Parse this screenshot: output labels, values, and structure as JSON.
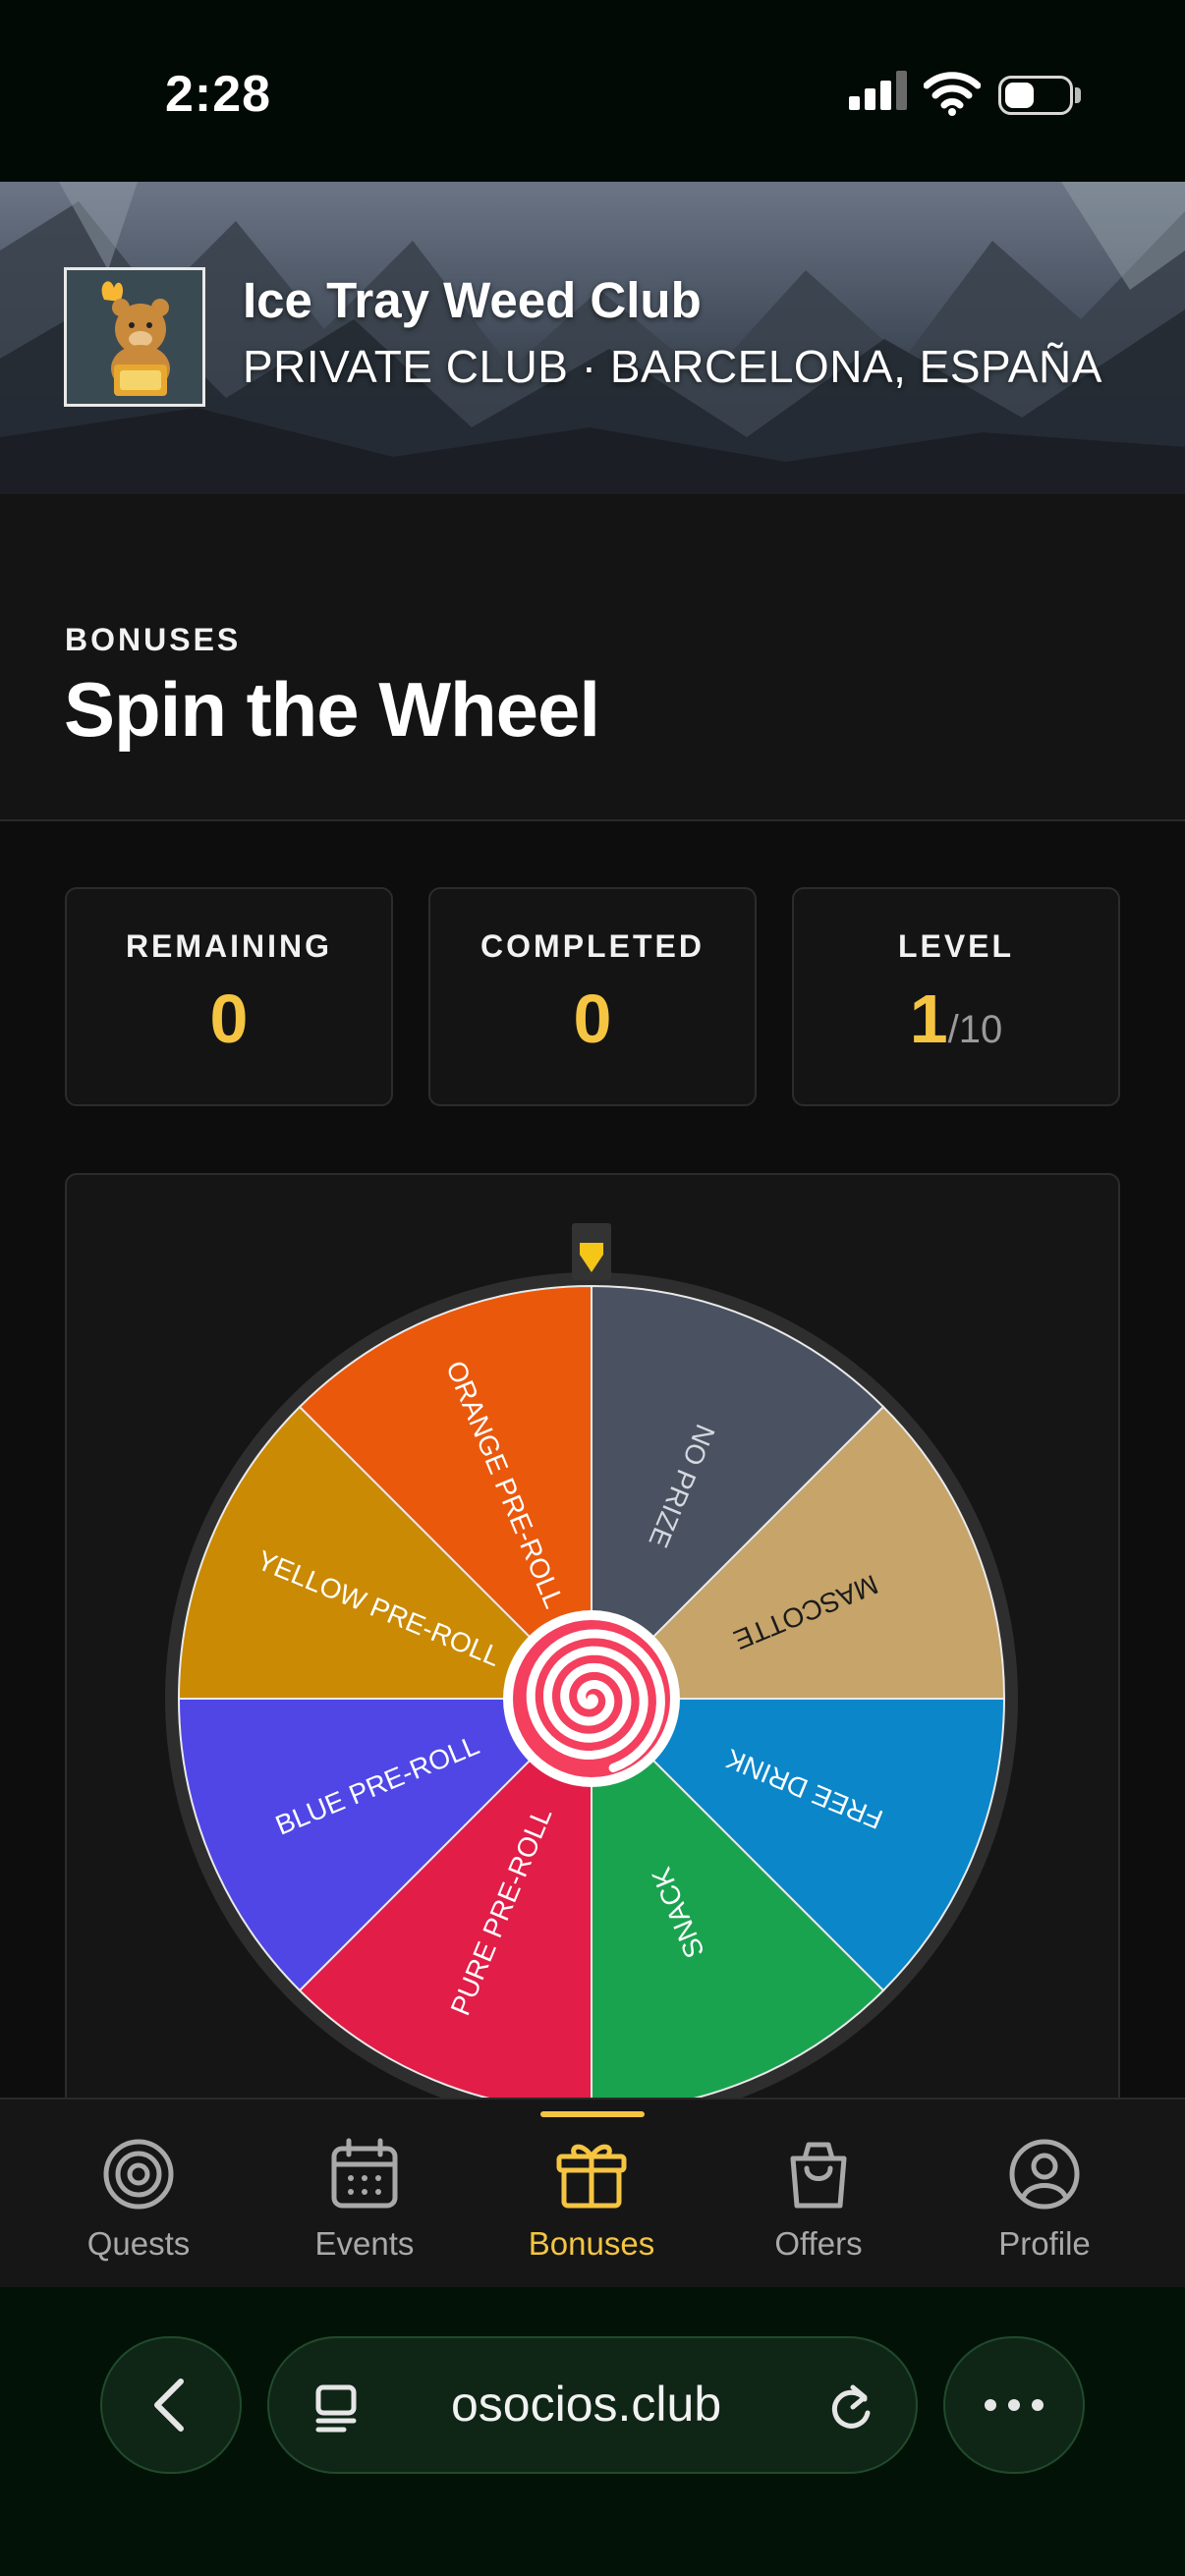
{
  "status_bar": {
    "time": "2:28",
    "battery_level": 0.45
  },
  "club": {
    "name": "Ice Tray Weed Club",
    "subtitle": "PRIVATE CLUB · BARCELONA, ESPAÑA"
  },
  "page": {
    "eyebrow": "BONUSES",
    "title": "Spin the Wheel"
  },
  "stats": {
    "remaining": {
      "label": "REMAINING",
      "value": "0"
    },
    "completed": {
      "label": "COMPLETED",
      "value": "0"
    },
    "level": {
      "label": "LEVEL",
      "value": "1",
      "max": "/10"
    }
  },
  "wheel": {
    "segments": [
      {
        "label": "NO PRIZE",
        "color": "#4a5261",
        "text_color": "#d5d8de"
      },
      {
        "label": "MASCOTTE",
        "color": "#c6a46a",
        "text_color": "#1b1b1b"
      },
      {
        "label": "FREE DRINK",
        "color": "#0a86c9",
        "text_color": "#ffffff"
      },
      {
        "label": "SNACK",
        "color": "#1aa34f",
        "text_color": "#ffffff"
      },
      {
        "label": "PURE PRE-ROLL",
        "color": "#e11d48",
        "text_color": "#ffffff"
      },
      {
        "label": "BLUE PRE-ROLL",
        "color": "#4f46e5",
        "text_color": "#ffffff"
      },
      {
        "label": "YELLOW PRE-ROLL",
        "color": "#ca8a04",
        "text_color": "#ffffff"
      },
      {
        "label": "ORANGE PRE-ROLL",
        "color": "#ea580c",
        "text_color": "#ffffff"
      }
    ],
    "pointer_color": "#f5c518",
    "rim_color": "#2e2e2e"
  },
  "nav": {
    "items": [
      {
        "label": "Quests",
        "icon": "target-icon"
      },
      {
        "label": "Events",
        "icon": "calendar-icon"
      },
      {
        "label": "Bonuses",
        "icon": "gift-icon",
        "active": true
      },
      {
        "label": "Offers",
        "icon": "shopping-bag-icon"
      },
      {
        "label": "Profile",
        "icon": "user-circle-icon"
      }
    ]
  },
  "browser": {
    "url": "osocios.club"
  },
  "colors": {
    "accent": "#f5c542",
    "background": "#0d0d0d"
  }
}
